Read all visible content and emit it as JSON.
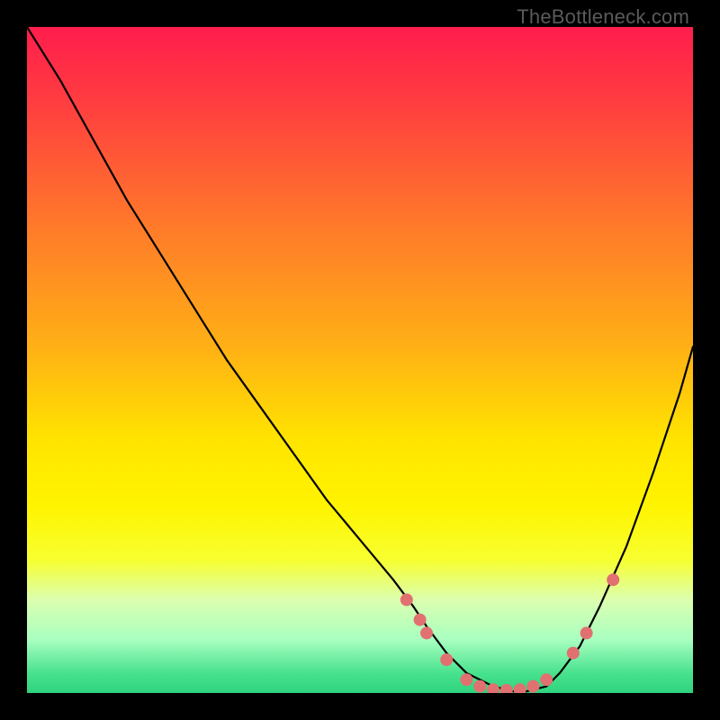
{
  "watermark": "TheBottleneck.com",
  "chart_data": {
    "type": "line",
    "title": "",
    "xlabel": "",
    "ylabel": "",
    "xlim": [
      0,
      100
    ],
    "ylim": [
      0,
      100
    ],
    "background_gradient": {
      "stops": [
        {
          "offset": 0.0,
          "color": "#ff1d4d"
        },
        {
          "offset": 0.12,
          "color": "#ff3f3f"
        },
        {
          "offset": 0.3,
          "color": "#ff7a2a"
        },
        {
          "offset": 0.48,
          "color": "#ffb015"
        },
        {
          "offset": 0.62,
          "color": "#ffe400"
        },
        {
          "offset": 0.72,
          "color": "#fff400"
        },
        {
          "offset": 0.8,
          "color": "#f7ff30"
        },
        {
          "offset": 0.86,
          "color": "#dcffb0"
        },
        {
          "offset": 0.92,
          "color": "#a8ffc0"
        },
        {
          "offset": 0.97,
          "color": "#48e28e"
        },
        {
          "offset": 1.0,
          "color": "#2fd37e"
        }
      ]
    },
    "series": [
      {
        "name": "bottleneck-curve",
        "color": "#000000",
        "x": [
          0,
          5,
          10,
          15,
          20,
          25,
          30,
          35,
          40,
          45,
          50,
          55,
          58,
          60,
          63,
          66,
          70,
          74,
          78,
          80,
          83,
          86,
          90,
          94,
          98,
          100
        ],
        "values": [
          100,
          92,
          83,
          74,
          66,
          58,
          50,
          43,
          36,
          29,
          23,
          17,
          13,
          10,
          6,
          3,
          1,
          0,
          1,
          3,
          7,
          13,
          22,
          33,
          45,
          52
        ]
      }
    ],
    "markers": {
      "color": "#e17070",
      "radius": 7,
      "points": [
        {
          "x": 57,
          "y": 14
        },
        {
          "x": 59,
          "y": 11
        },
        {
          "x": 60,
          "y": 9
        },
        {
          "x": 63,
          "y": 5
        },
        {
          "x": 66,
          "y": 2
        },
        {
          "x": 68,
          "y": 1
        },
        {
          "x": 70,
          "y": 0.5
        },
        {
          "x": 72,
          "y": 0.4
        },
        {
          "x": 74,
          "y": 0.5
        },
        {
          "x": 76,
          "y": 1
        },
        {
          "x": 78,
          "y": 2
        },
        {
          "x": 82,
          "y": 6
        },
        {
          "x": 84,
          "y": 9
        },
        {
          "x": 88,
          "y": 17
        }
      ]
    }
  }
}
